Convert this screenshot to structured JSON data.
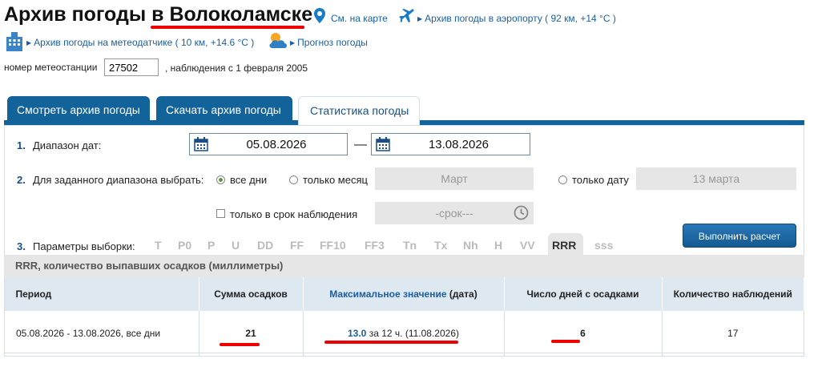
{
  "header": {
    "title_prefix": "Архив погоды",
    "title_city": "в Волоколамске",
    "map_link": "См. на карте",
    "airport_link": "Архив погоды в аэропорту ( 92 км, +14 °C )",
    "sensor_link": "Архив погоды на метеодатчике ( 10 км, +14.6 °C )",
    "forecast_link": "Прогноз погоды"
  },
  "station": {
    "label": "номер метеостанции",
    "value": "27502",
    "since": ", наблюдения с 1 февраля 2005"
  },
  "tabs": [
    {
      "label": "Смотреть архив погоды"
    },
    {
      "label": "Скачать архив погоды"
    },
    {
      "label": "Статистика погоды"
    }
  ],
  "form": {
    "step1_num": "1.",
    "step1_label": "Диапазон дат:",
    "date_from": "05.08.2026",
    "date_sep": "—",
    "date_to": "13.08.2026",
    "step2_num": "2.",
    "step2_label": "Для заданного диапазона выбрать:",
    "opt_all": "все дни",
    "opt_month": "только месяц",
    "month_value": "Март",
    "opt_date": "только дату",
    "date_value": "13 марта",
    "opt_obs_time": "только в срок наблюдения",
    "obs_time_value": "-срок---",
    "step3_num": "3.",
    "step3_label": "Параметры выборки:",
    "params": [
      "T",
      "P0",
      "P",
      "U",
      "DD",
      "FF",
      "FF10",
      "FF3",
      "Tn",
      "Tx",
      "Nh",
      "H",
      "VV",
      "RRR",
      "sss"
    ],
    "selected_param": "RRR",
    "calc_button": "Выполнить расчет"
  },
  "result": {
    "description": "RRR, количество выпавших осадков (миллиметры)",
    "columns": {
      "period": "Период",
      "sum": "Сумма осадков",
      "max_label": "Максимальное значение",
      "max_suffix": "(дата)",
      "days": "Число дней с осадками",
      "count": "Количество наблюдений"
    },
    "row": {
      "period": "05.08.2026 - 13.08.2026, все дни",
      "sum": "21",
      "max_value": "13.0",
      "max_mid": "за 12 ч.",
      "max_date": "(11.08.2026)",
      "days": "6",
      "count": "17"
    }
  },
  "colors": {
    "tab_dark": "#13639b",
    "link": "#1a5fa3",
    "underline_red": "#e00000",
    "button": "#135a92"
  }
}
